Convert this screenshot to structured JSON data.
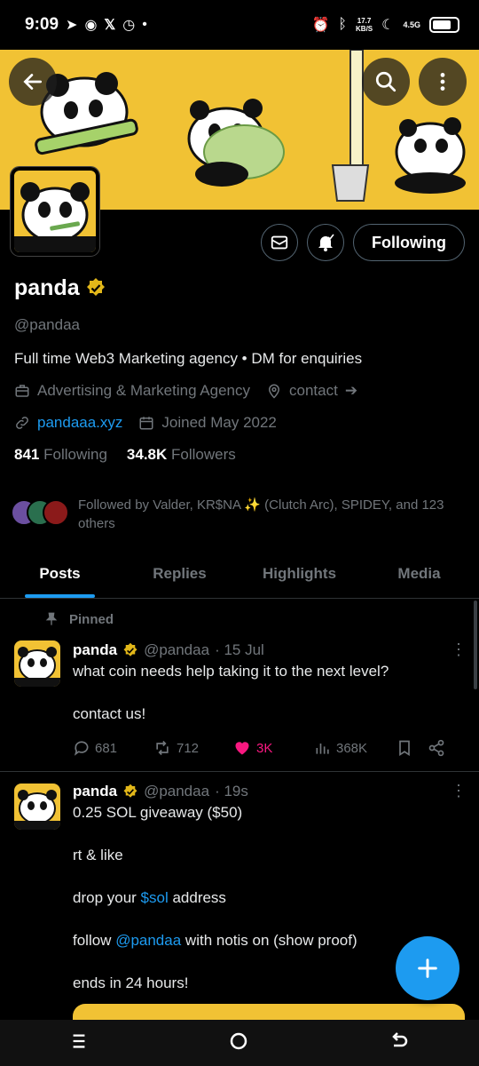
{
  "status": {
    "time": "9:09",
    "net_speed_value": "17.7",
    "net_speed_unit": "KB/S",
    "network": "4.5G"
  },
  "profile": {
    "name": "panda",
    "handle": "@pandaa",
    "bio": "Full time Web3 Marketing agency • DM for enquiries",
    "category": "Advertising & Marketing Agency",
    "contact": "contact",
    "website": "pandaaa.xyz",
    "joined": "Joined May 2022",
    "following_count": "841",
    "following_label": "Following",
    "followers_count": "34.8K",
    "followers_label": "Followers",
    "follow_button": "Following",
    "followed_by": "Followed by Valder, KR$NA ✨ (Clutch Arc), SPIDEY, and 123 others"
  },
  "tabs": [
    "Posts",
    "Replies",
    "Highlights",
    "Media"
  ],
  "posts": [
    {
      "pinned_label": "Pinned",
      "name": "panda",
      "handle": "@pandaa",
      "time": "· 15 Jul",
      "lines": [
        "what coin needs help taking it to the next level?",
        "",
        "contact us!"
      ],
      "replies": "681",
      "reposts": "712",
      "likes": "3K",
      "views": "368K"
    },
    {
      "name": "panda",
      "handle": "@pandaa",
      "time": "· 19s",
      "line1": "0.25 SOL giveaway ($50)",
      "line2": "rt & like",
      "line3_pre": "drop your ",
      "line3_link": "$sol",
      "line3_post": " address",
      "line4_pre": "follow ",
      "line4_link": "@pandaa",
      "line4_post": " with notis on (show proof)",
      "line5": "ends in 24 hours!"
    }
  ],
  "colors": {
    "accent": "#1d9bf0",
    "like": "#f91880",
    "banner": "#f1c234",
    "verified": "#e2b719"
  },
  "icons": [
    "back-icon",
    "search-icon",
    "more-icon",
    "message-icon",
    "notification-icon",
    "briefcase-icon",
    "location-icon",
    "link-icon",
    "calendar-icon",
    "pin-icon",
    "reply-icon",
    "repost-icon",
    "like-icon",
    "views-icon",
    "bookmark-icon",
    "share-icon",
    "plus-icon"
  ]
}
